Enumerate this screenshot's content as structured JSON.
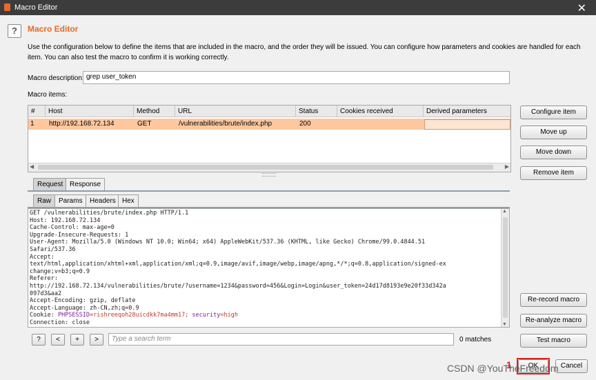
{
  "window": {
    "title": "Macro Editor",
    "close_glyph": "✕"
  },
  "header": {
    "help_glyph": "?",
    "title": "Macro Editor",
    "description": "Use the configuration below to define the items that are included in the macro, and the order they will be issued. You can configure how parameters and cookies are handled for each item. You can also test the macro to confirm it is working correctly."
  },
  "macro_description": {
    "label": "Macro description:",
    "value": "grep user_token"
  },
  "macro_items": {
    "label": "Macro items:",
    "columns": [
      "#",
      "Host",
      "Method",
      "URL",
      "Status",
      "Cookies received",
      "Derived parameters"
    ],
    "rows": [
      {
        "num": "1",
        "host": "http://192.168.72.134",
        "method": "GET",
        "url": "/vulnerabilities/brute/index.php",
        "status": "200",
        "cookies": "",
        "derived": ""
      }
    ]
  },
  "item_buttons": {
    "configure": "Configure item",
    "move_up": "Move up",
    "move_down": "Move down",
    "remove": "Remove item"
  },
  "tabs": {
    "request": "Request",
    "response": "Response"
  },
  "subtabs": {
    "raw": "Raw",
    "params": "Params",
    "headers": "Headers",
    "hex": "Hex"
  },
  "request_lines": [
    "GET /vulnerabilities/brute/index.php HTTP/1.1",
    "Host: 192.168.72.134",
    "Cache-Control: max-age=0",
    "Upgrade-Insecure-Requests: 1",
    "User-Agent: Mozilla/5.0 (Windows NT 10.0; Win64; x64) AppleWebKit/537.36 (KHTML, like Gecko) Chrome/99.0.4844.51",
    "Safari/537.36",
    "Accept:",
    "text/html,application/xhtml+xml,application/xml;q=0.9,image/avif,image/webp,image/apng,*/*;q=0.8,application/signed-ex",
    "change;v=b3;q=0.9",
    "Referer:",
    "http://192.168.72.134/vulnerabilities/brute/?username=1234&password=456&Login=Login&user_token=24d17d8193e9e20f33d342a",
    "097d3&aa2",
    "Accept-Encoding: gzip, deflate",
    "Accept-Language: zh-CN,zh;q=0.9"
  ],
  "cookie_line": {
    "prefix": "Cookie: ",
    "name1": "PHPSESSID",
    "value1": "=rishreeqoh28uicdkk7ma4mm17; ",
    "name2": "security",
    "value2": "=high"
  },
  "last_line": "Connection: close",
  "search": {
    "help": "?",
    "prev": "<",
    "add": "+",
    "next": ">",
    "placeholder": "Type a search term",
    "matches": "0 matches"
  },
  "side_buttons": {
    "rerecord": "Re-record macro",
    "reanalyze": "Re-analyze macro",
    "test": "Test macro"
  },
  "footer": {
    "ok": "OK",
    "cancel": "Cancel",
    "annotation": "1",
    "watermark": "CSDN @YouTheFreedom"
  },
  "colors": {
    "accent": "#e8692a",
    "selected_row": "#fdc79f",
    "annotation": "#e02020",
    "cookie_name": "#7a1f9c",
    "cookie_value": "#c0392b"
  }
}
